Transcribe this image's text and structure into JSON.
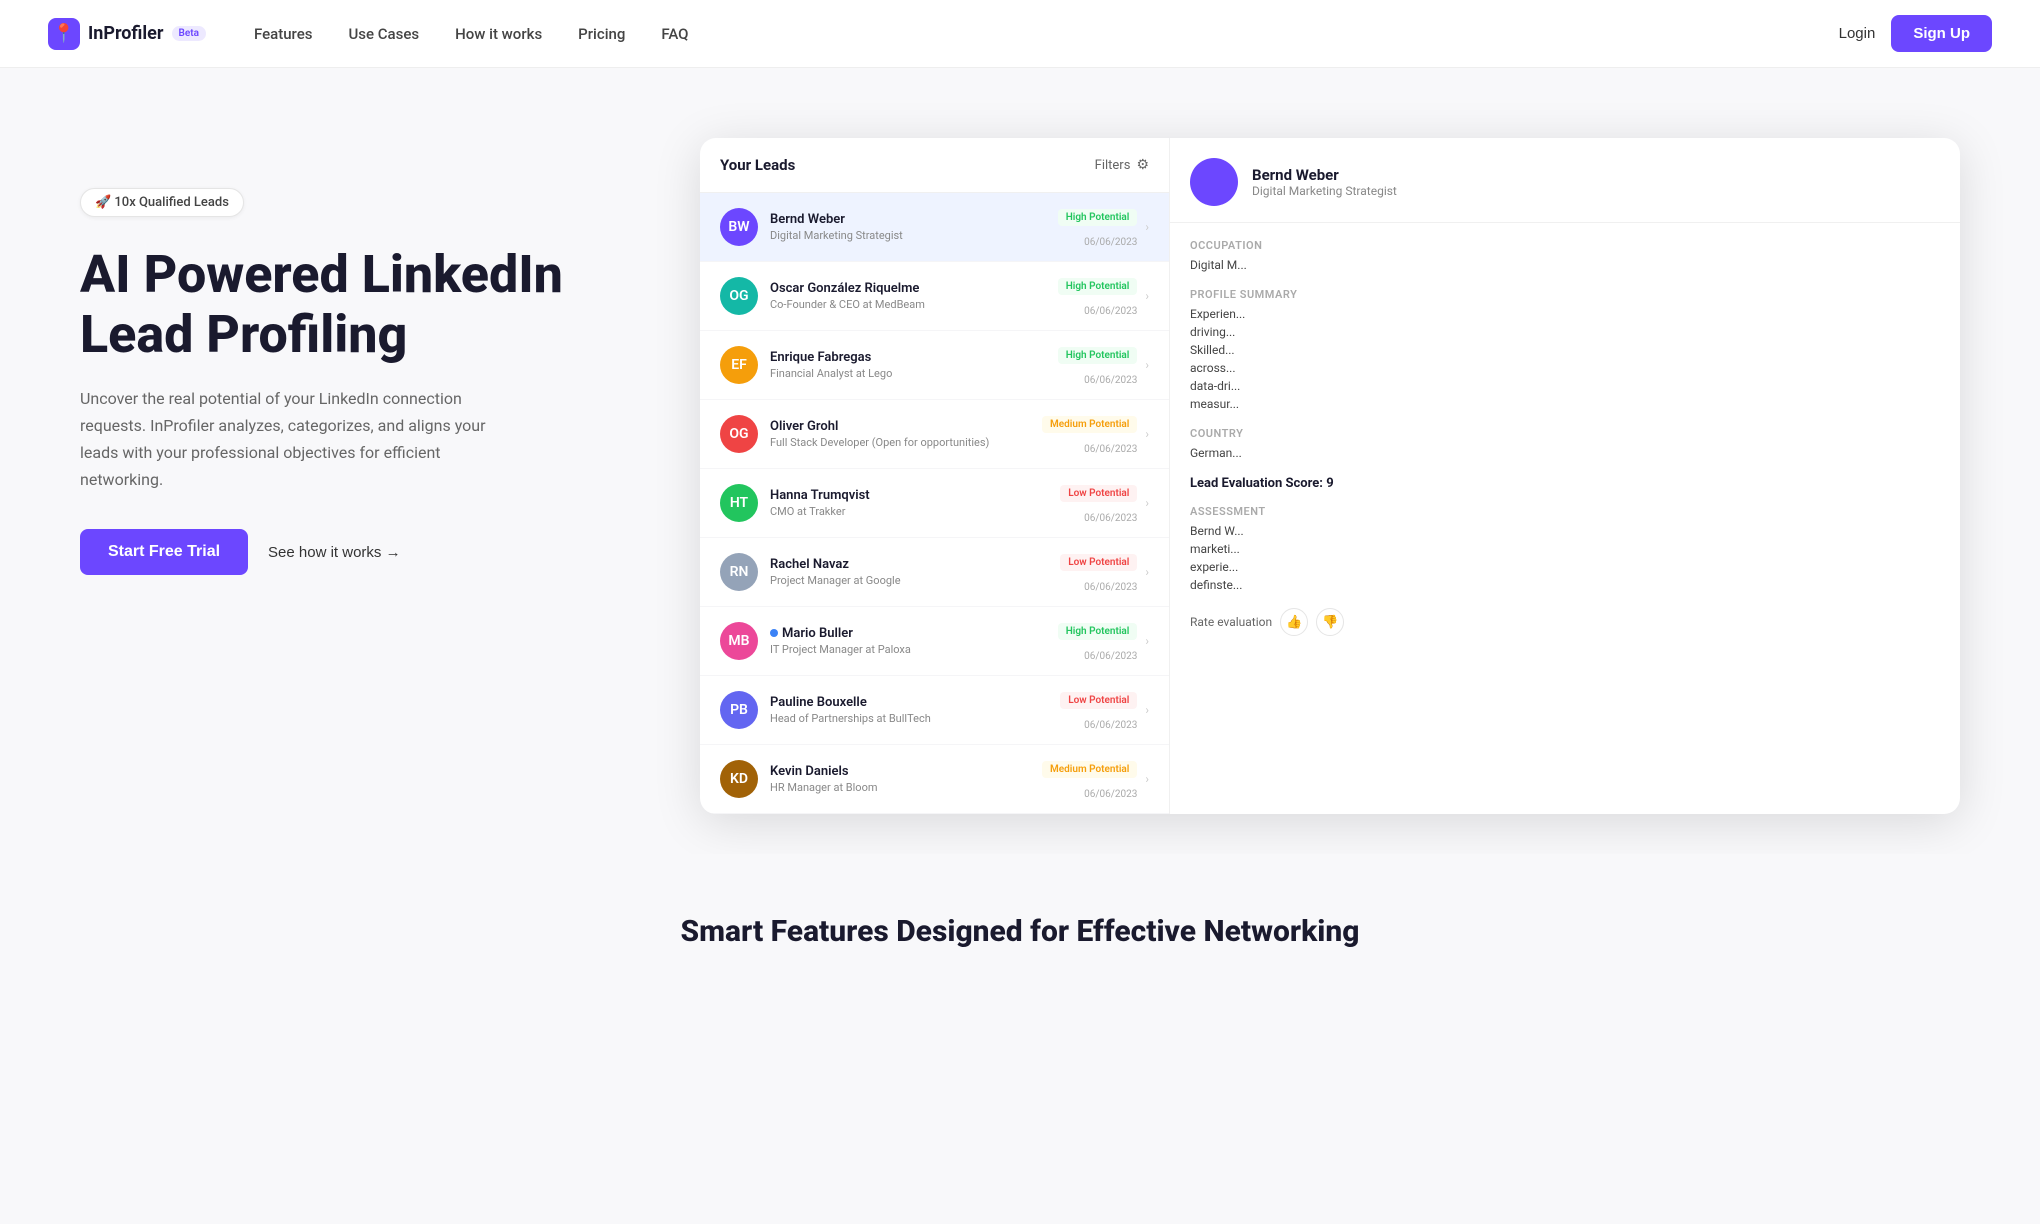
{
  "nav": {
    "logo_text": "InProfiler",
    "beta": "Beta",
    "links": [
      "Features",
      "Use Cases",
      "How it works",
      "Pricing",
      "FAQ"
    ],
    "login": "Login",
    "signup": "Sign Up"
  },
  "hero": {
    "badge": "🚀 10x Qualified Leads",
    "title_line1": "AI Powered LinkedIn",
    "title_line2": "Lead Profiling",
    "description": "Uncover the real potential of your LinkedIn connection requests. InProfiler analyzes, categorizes, and aligns your leads with your professional objectives for efficient networking.",
    "cta_trial": "Start Free Trial",
    "cta_how": "See how it works →"
  },
  "dashboard": {
    "title": "Your Leads",
    "filters": "Filters",
    "leads": [
      {
        "name": "Bernd Weber",
        "title": "Digital Marketing Strategist",
        "badge": "High Potential",
        "badge_type": "high",
        "date": "06/06/2023",
        "active": true,
        "initials": "BW"
      },
      {
        "name": "Oscar González Riquelme",
        "title": "Co-Founder & CEO at MedBeam",
        "badge": "High Potential",
        "badge_type": "high",
        "date": "06/06/2023",
        "active": false,
        "initials": "OG"
      },
      {
        "name": "Enrique Fabregas",
        "title": "Financial Analyst at Lego",
        "badge": "High Potential",
        "badge_type": "high",
        "date": "06/06/2023",
        "active": false,
        "initials": "EF"
      },
      {
        "name": "Oliver Grohl",
        "title": "Full Stack Developer (Open for opportunities)",
        "badge": "Medium Potential",
        "badge_type": "medium",
        "date": "06/06/2023",
        "active": false,
        "initials": "OG"
      },
      {
        "name": "Hanna Trumqvist",
        "title": "CMO at Trakker",
        "badge": "Low Potential",
        "badge_type": "low",
        "date": "06/06/2023",
        "active": false,
        "initials": "HT"
      },
      {
        "name": "Rachel Navaz",
        "title": "Project Manager at Google",
        "badge": "Low Potential",
        "badge_type": "low",
        "date": "06/06/2023",
        "active": false,
        "initials": "RN"
      },
      {
        "name": "Mario Buller",
        "title": "IT Project Manager at Paloxa",
        "badge": "High Potential",
        "badge_type": "high",
        "date": "06/06/2023",
        "active": false,
        "initials": "MB",
        "online": true
      },
      {
        "name": "Pauline Bouxelle",
        "title": "Head of Partnerships at BullTech",
        "badge": "Low Potential",
        "badge_type": "low",
        "date": "06/06/2023",
        "active": false,
        "initials": "PB"
      },
      {
        "name": "Kevin Daniels",
        "title": "HR Manager at Bloom",
        "badge": "Medium Potential",
        "badge_type": "medium",
        "date": "06/06/2023",
        "active": false,
        "initials": "KD"
      }
    ],
    "detail": {
      "name": "Bernd Weber",
      "subtitle": "Digital Marketing Strategist",
      "occupation_label": "Occupation",
      "occupation_value": "Digital M...",
      "profile_summary_label": "Profile Summary",
      "profile_summary_value": "Experien... driving... Skilled... across... data-dri... measur...",
      "country_label": "Country",
      "country_value": "German...",
      "score_label": "Lead Evaluation Score: 9",
      "assessment_label": "Assessment",
      "assessment_value": "Bernd W... marketi... experie... definste...",
      "rate_label": "Rate evaluation"
    }
  },
  "bottom": {
    "title": "Smart Features Designed for Effective Networking"
  }
}
